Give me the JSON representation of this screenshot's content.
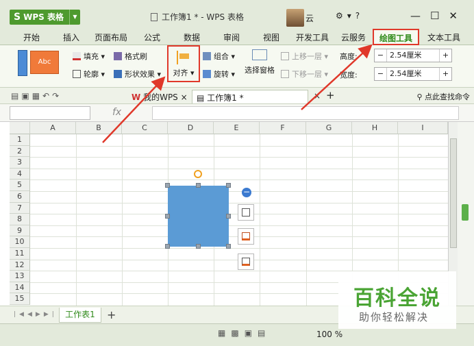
{
  "titlebar": {
    "app_name": "WPS 表格",
    "doc_title": "工作簿1 * - WPS 表格",
    "user": "云",
    "window_controls": [
      "—",
      "☐",
      "✕"
    ]
  },
  "tabs": [
    "开始",
    "插入",
    "页面布局",
    "公式",
    "数据",
    "审阅",
    "视图",
    "开发工具",
    "云服务",
    "绘图工具",
    "文本工具"
  ],
  "active_tab": "绘图工具",
  "ribbon": {
    "style_sample": "Abc",
    "fill": "填充",
    "format_painter": "格式刷",
    "outline": "轮廓",
    "shape_effects": "形状效果",
    "align": "对齐",
    "group": "组合",
    "rotate": "旋转",
    "selection_pane": "选择窗格",
    "bring_forward": "上移一层",
    "send_backward": "下移一层",
    "height_label": "高度:",
    "height_value": "2.54厘米",
    "width_label": "宽度:",
    "width_value": "2.54厘米"
  },
  "doc_tabs": {
    "my_wps": "我的WPS",
    "workbook": "工作簿1 *",
    "search": "点此查找命令"
  },
  "formula_bar": {
    "fx": "fx"
  },
  "grid": {
    "columns": [
      "A",
      "B",
      "C",
      "D",
      "E",
      "F",
      "G",
      "H",
      "I"
    ],
    "rows": [
      "1",
      "2",
      "3",
      "4",
      "5",
      "6",
      "7",
      "8",
      "9",
      "10",
      "11",
      "12",
      "13",
      "14",
      "15"
    ]
  },
  "sheets": {
    "tab": "工作表1",
    "add": "+"
  },
  "status": {
    "zoom": "100 %"
  },
  "watermark": {
    "title": "百科全说",
    "subtitle": "助你轻松解决"
  },
  "colors": {
    "accent_green": "#4e9a2e",
    "highlight_red": "#e0382a",
    "shape_fill": "#5b9bd5"
  }
}
